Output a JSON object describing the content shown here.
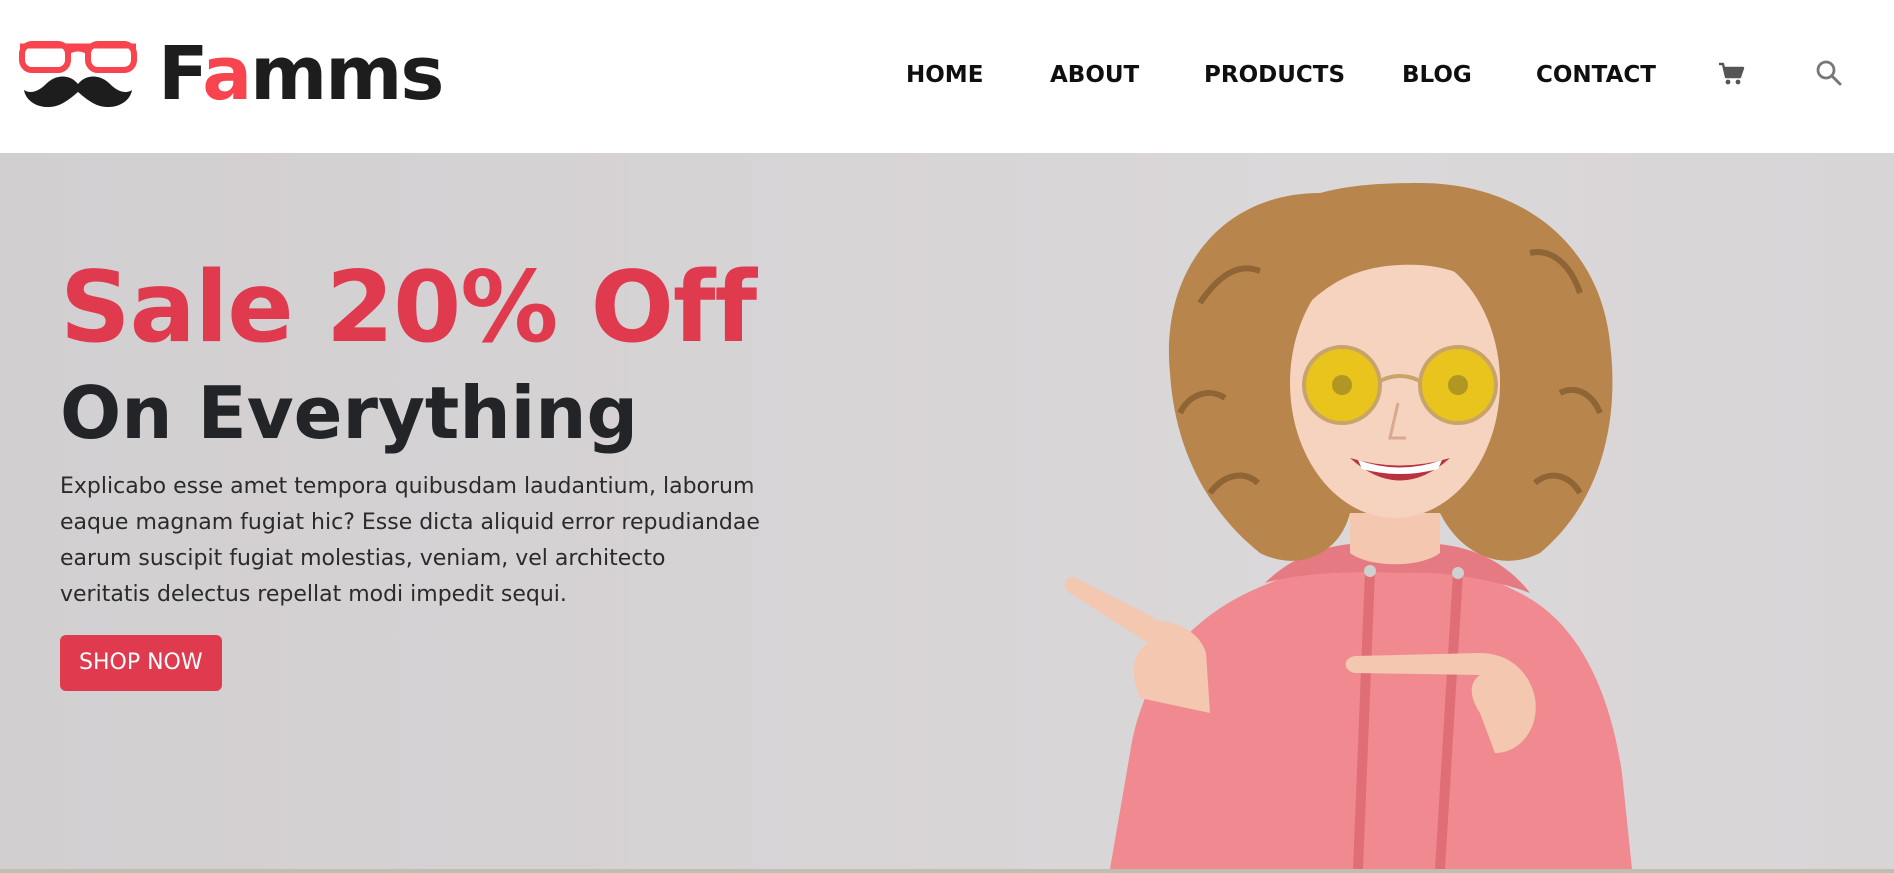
{
  "brand": {
    "name_prefix": "F",
    "name_accent": "a",
    "name_suffix": "mms",
    "accent_color": "#f7444e"
  },
  "nav": {
    "items": [
      {
        "label": "HOME"
      },
      {
        "label": "ABOUT"
      },
      {
        "label": "PRODUCTS"
      },
      {
        "label": "BLOG"
      },
      {
        "label": "CONTACT"
      }
    ],
    "icons": [
      "cart-icon",
      "search-icon"
    ]
  },
  "hero": {
    "title": "Sale 20% Off",
    "subtitle": "On Everything",
    "description": "Explicabo esse amet tempora quibusdam laudantium, laborum eaque magnam fugiat hic? Esse dicta aliquid error repudiandae earum suscipit fugiat molestias, veniam, vel architecto veritatis delectus repellat modi impedit sequi.",
    "cta_label": "SHOP NOW",
    "title_color": "#e03a4e",
    "button_color": "#e03a4e"
  }
}
